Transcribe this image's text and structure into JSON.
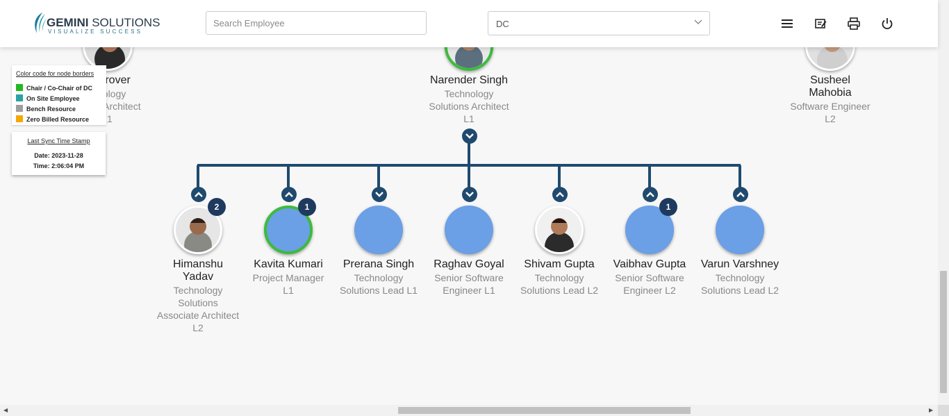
{
  "header": {
    "logo_main": "GEMINI",
    "logo_sub": "SOLUTIONS",
    "logo_tagline": "VISUALIZE SUCCESS",
    "search_placeholder": "Search Employee",
    "department_selected": "DC",
    "icons": [
      "menu-icon",
      "report-icon",
      "print-icon",
      "power-icon"
    ]
  },
  "legend": {
    "title": "Color code for node borders",
    "items": [
      {
        "label": "Chair / Co-Chair of DC",
        "color": "#22b922"
      },
      {
        "label": "On Site Employee",
        "color": "#2aa3a3"
      },
      {
        "label": "Bench Resource",
        "color": "#9e9e9e"
      },
      {
        "label": "Zero Billed Resource",
        "color": "#f4a700"
      }
    ]
  },
  "sync": {
    "title": "Last Sync Time Stamp",
    "date": "Date: 2023-11-28",
    "time": "Time: 2:06:04 PM"
  },
  "top_nodes": [
    {
      "name": "t Grover",
      "line1": "nology",
      "line2": "s Architect",
      "line3": "1"
    },
    {
      "name": "Narender Singh",
      "line1": "Technology",
      "line2": "Solutions Architect",
      "line3": "L1"
    },
    {
      "name1": "Susheel",
      "name2": "Mahobia",
      "line1": "Software Engineer",
      "line2": "L2"
    }
  ],
  "children": [
    {
      "name1": "Himanshu",
      "name2": "Yadav",
      "l1": "Technology",
      "l2": "Solutions",
      "l3": "Associate Architect",
      "l4": "L2",
      "badge": "2"
    },
    {
      "name1": "Kavita Kumari",
      "l1": "Project Manager",
      "l2": "L1",
      "badge": "1"
    },
    {
      "name1": "Prerana Singh",
      "l1": "Technology",
      "l2": "Solutions Lead L1"
    },
    {
      "name1": "Raghav Goyal",
      "l1": "Senior Software",
      "l2": "Engineer L1"
    },
    {
      "name1": "Shivam Gupta",
      "l1": "Technology",
      "l2": "Solutions Lead L2"
    },
    {
      "name1": "Vaibhav Gupta",
      "l1": "Senior Software",
      "l2": "Engineer L2",
      "badge": "1"
    },
    {
      "name1": "Varun Varshney",
      "l1": "Technology",
      "l2": "Solutions Lead L2"
    }
  ],
  "colors": {
    "connector": "#1f4a6e",
    "avatar_placeholder": "#6b9fe6",
    "chair_border": "#3dbb3d",
    "badge": "#1f3a5f"
  }
}
